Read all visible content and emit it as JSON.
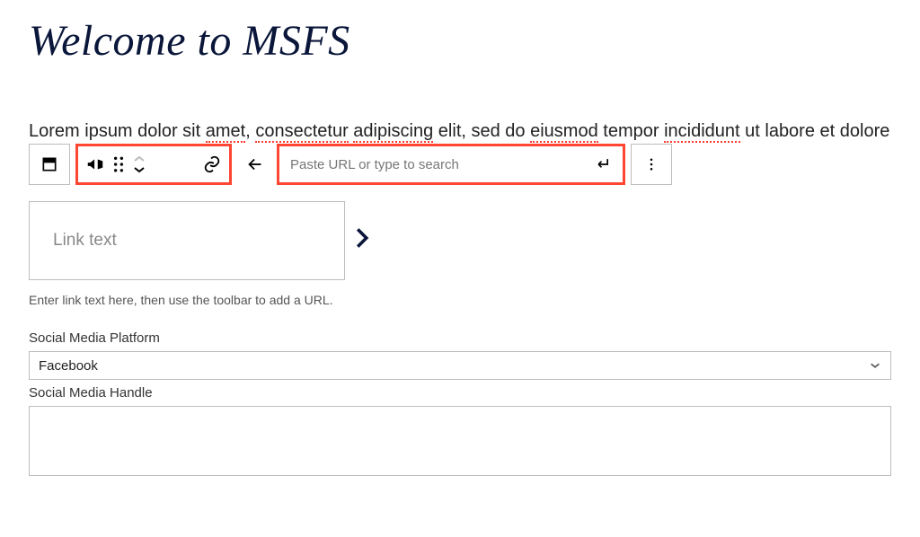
{
  "title": "Welcome to MSFS",
  "paragraph": {
    "pre1": "Lorem ipsum dolor sit ",
    "w1": "amet",
    "sep1": ", ",
    "w2": "consectetur",
    "sep2": " ",
    "w3": "adipiscing",
    "mid": " elit, sed do ",
    "w4": "eiusmod",
    "mid2": " tempor ",
    "w5": "incididunt",
    "post": " ut labore et dolore"
  },
  "toolbar": {
    "url_placeholder": "Paste URL or type to search"
  },
  "link_block": {
    "placeholder": "Link text",
    "helper": "Enter link text here, then use the toolbar to add a URL."
  },
  "fields": {
    "platform_label": "Social Media Platform",
    "platform_value": "Facebook",
    "handle_label": "Social Media Handle",
    "handle_value": ""
  }
}
